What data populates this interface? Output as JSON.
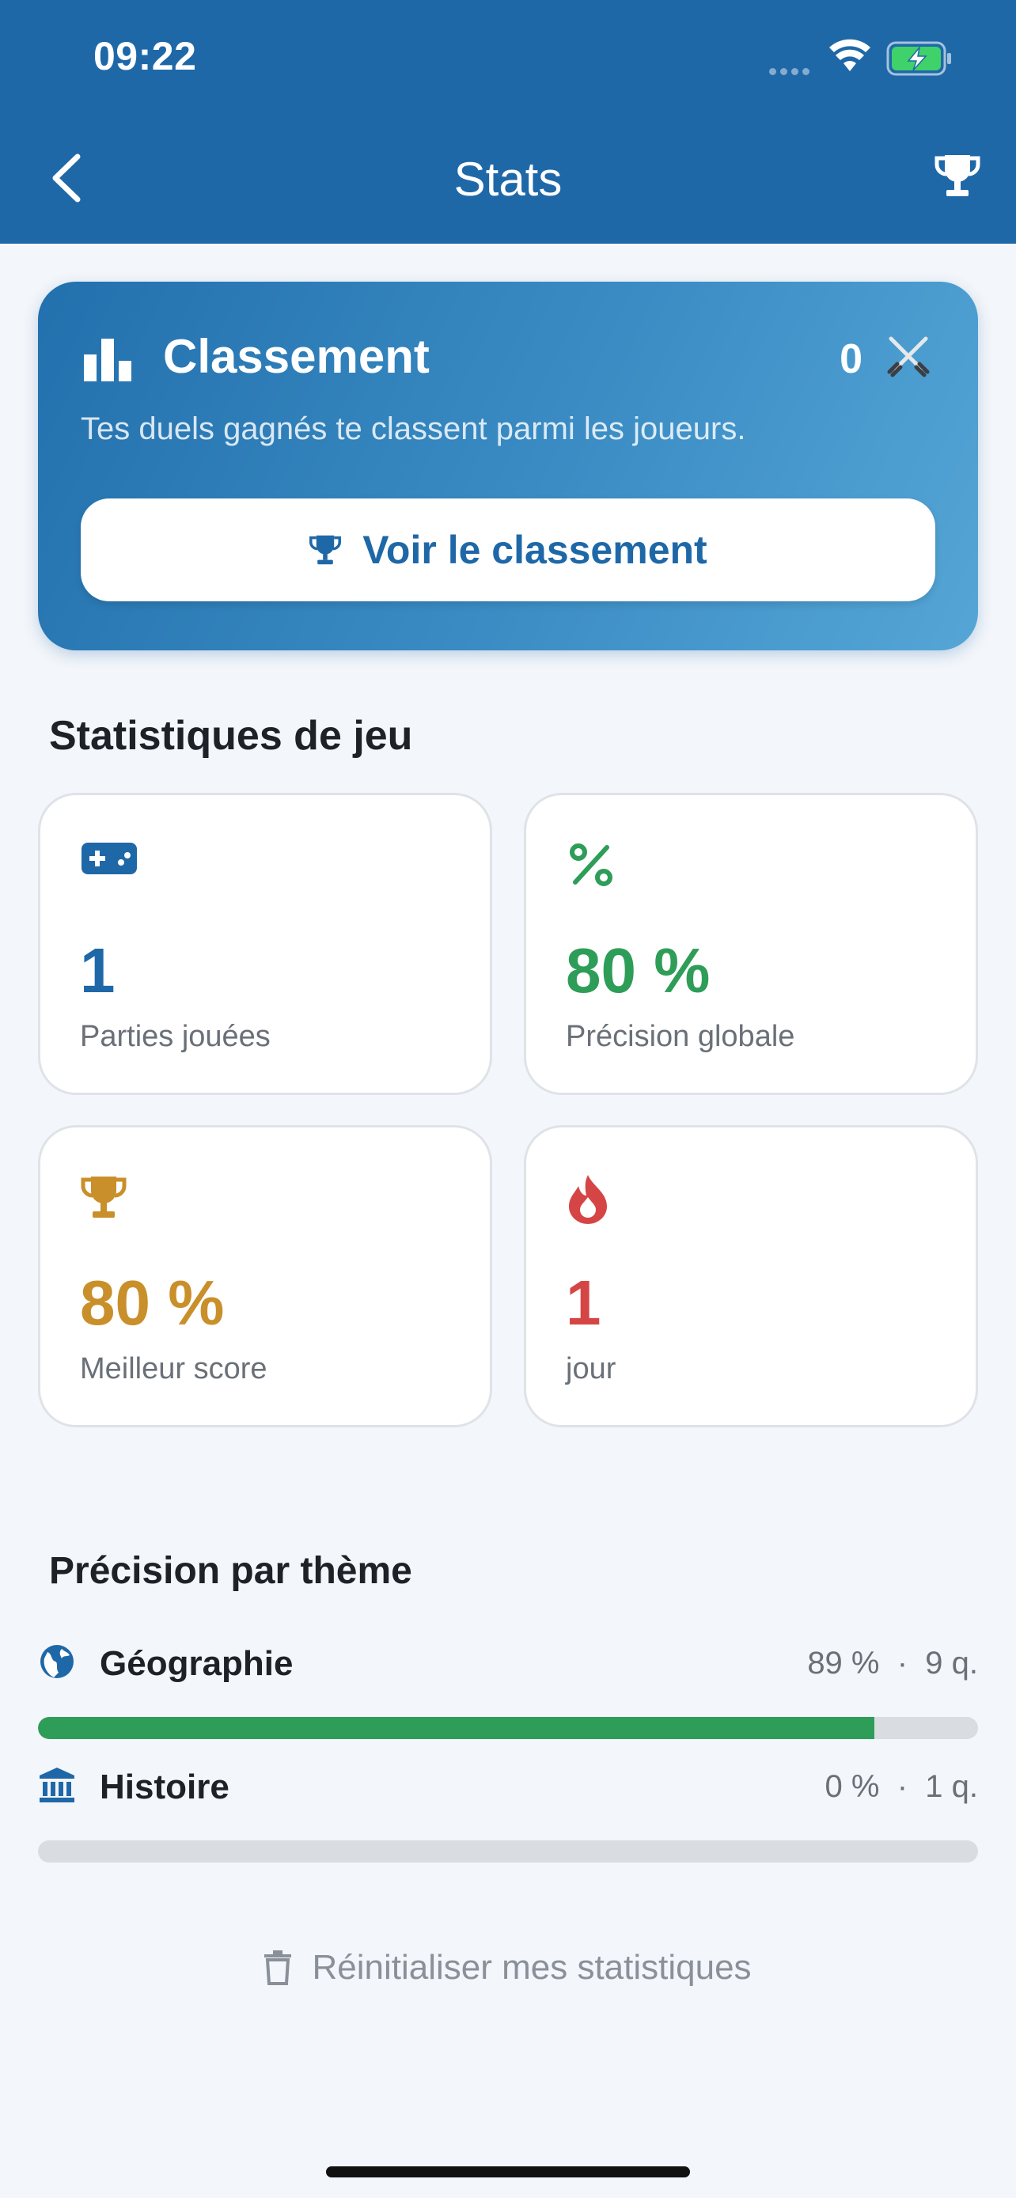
{
  "status_bar": {
    "time": "09:22"
  },
  "header": {
    "title": "Stats"
  },
  "ranking": {
    "title": "Classement",
    "score": "0",
    "description": "Tes duels gagnés te classent parmi les joueurs.",
    "button_label": "Voir le classement"
  },
  "game_stats": {
    "title": "Statistiques de jeu",
    "cards": [
      {
        "icon": "gamepad-icon",
        "value": "1",
        "label": "Parties jouées",
        "color": "#1f68a8"
      },
      {
        "icon": "percent-icon",
        "value": "80 %",
        "label": "Précision globale",
        "color": "#2e9d58"
      },
      {
        "icon": "trophy-icon",
        "value": "80 %",
        "label": "Meilleur score",
        "color": "#c98f2a"
      },
      {
        "icon": "flame-icon",
        "value": "1",
        "label": "jour",
        "color": "#d64545"
      }
    ]
  },
  "themes": {
    "title": "Précision par thème",
    "items": [
      {
        "icon": "globe-icon",
        "name": "Géographie",
        "percent_text": "89 %",
        "separator": "·",
        "count_text": "9 q.",
        "progress": 0.89
      },
      {
        "icon": "museum-icon",
        "name": "Histoire",
        "percent_text": "0 %",
        "separator": "·",
        "count_text": "1 q.",
        "progress": 0
      }
    ]
  },
  "reset": {
    "label": "Réinitialiser mes statistiques"
  },
  "colors": {
    "header": "#1f68a8",
    "accent_blue": "#1f68a8",
    "accent_green": "#2e9d58",
    "accent_gold": "#c98f2a",
    "accent_red": "#d64545"
  }
}
